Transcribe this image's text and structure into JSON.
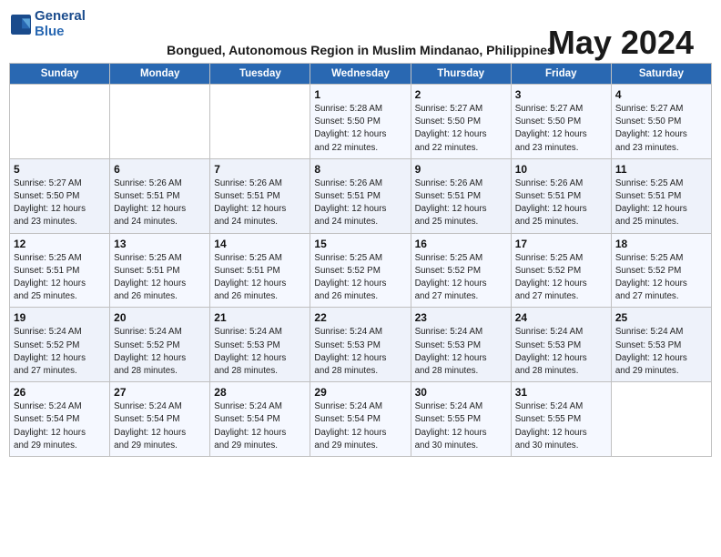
{
  "logo": {
    "line1": "General",
    "line2": "Blue"
  },
  "title": "May 2024",
  "subtitle": "Bongued, Autonomous Region in Muslim Mindanao, Philippines",
  "days_of_week": [
    "Sunday",
    "Monday",
    "Tuesday",
    "Wednesday",
    "Thursday",
    "Friday",
    "Saturday"
  ],
  "weeks": [
    [
      {
        "day": "",
        "info": ""
      },
      {
        "day": "",
        "info": ""
      },
      {
        "day": "",
        "info": ""
      },
      {
        "day": "1",
        "info": "Sunrise: 5:28 AM\nSunset: 5:50 PM\nDaylight: 12 hours\nand 22 minutes."
      },
      {
        "day": "2",
        "info": "Sunrise: 5:27 AM\nSunset: 5:50 PM\nDaylight: 12 hours\nand 22 minutes."
      },
      {
        "day": "3",
        "info": "Sunrise: 5:27 AM\nSunset: 5:50 PM\nDaylight: 12 hours\nand 23 minutes."
      },
      {
        "day": "4",
        "info": "Sunrise: 5:27 AM\nSunset: 5:50 PM\nDaylight: 12 hours\nand 23 minutes."
      }
    ],
    [
      {
        "day": "5",
        "info": "Sunrise: 5:27 AM\nSunset: 5:50 PM\nDaylight: 12 hours\nand 23 minutes."
      },
      {
        "day": "6",
        "info": "Sunrise: 5:26 AM\nSunset: 5:51 PM\nDaylight: 12 hours\nand 24 minutes."
      },
      {
        "day": "7",
        "info": "Sunrise: 5:26 AM\nSunset: 5:51 PM\nDaylight: 12 hours\nand 24 minutes."
      },
      {
        "day": "8",
        "info": "Sunrise: 5:26 AM\nSunset: 5:51 PM\nDaylight: 12 hours\nand 24 minutes."
      },
      {
        "day": "9",
        "info": "Sunrise: 5:26 AM\nSunset: 5:51 PM\nDaylight: 12 hours\nand 25 minutes."
      },
      {
        "day": "10",
        "info": "Sunrise: 5:26 AM\nSunset: 5:51 PM\nDaylight: 12 hours\nand 25 minutes."
      },
      {
        "day": "11",
        "info": "Sunrise: 5:25 AM\nSunset: 5:51 PM\nDaylight: 12 hours\nand 25 minutes."
      }
    ],
    [
      {
        "day": "12",
        "info": "Sunrise: 5:25 AM\nSunset: 5:51 PM\nDaylight: 12 hours\nand 25 minutes."
      },
      {
        "day": "13",
        "info": "Sunrise: 5:25 AM\nSunset: 5:51 PM\nDaylight: 12 hours\nand 26 minutes."
      },
      {
        "day": "14",
        "info": "Sunrise: 5:25 AM\nSunset: 5:51 PM\nDaylight: 12 hours\nand 26 minutes."
      },
      {
        "day": "15",
        "info": "Sunrise: 5:25 AM\nSunset: 5:52 PM\nDaylight: 12 hours\nand 26 minutes."
      },
      {
        "day": "16",
        "info": "Sunrise: 5:25 AM\nSunset: 5:52 PM\nDaylight: 12 hours\nand 27 minutes."
      },
      {
        "day": "17",
        "info": "Sunrise: 5:25 AM\nSunset: 5:52 PM\nDaylight: 12 hours\nand 27 minutes."
      },
      {
        "day": "18",
        "info": "Sunrise: 5:25 AM\nSunset: 5:52 PM\nDaylight: 12 hours\nand 27 minutes."
      }
    ],
    [
      {
        "day": "19",
        "info": "Sunrise: 5:24 AM\nSunset: 5:52 PM\nDaylight: 12 hours\nand 27 minutes."
      },
      {
        "day": "20",
        "info": "Sunrise: 5:24 AM\nSunset: 5:52 PM\nDaylight: 12 hours\nand 28 minutes."
      },
      {
        "day": "21",
        "info": "Sunrise: 5:24 AM\nSunset: 5:53 PM\nDaylight: 12 hours\nand 28 minutes."
      },
      {
        "day": "22",
        "info": "Sunrise: 5:24 AM\nSunset: 5:53 PM\nDaylight: 12 hours\nand 28 minutes."
      },
      {
        "day": "23",
        "info": "Sunrise: 5:24 AM\nSunset: 5:53 PM\nDaylight: 12 hours\nand 28 minutes."
      },
      {
        "day": "24",
        "info": "Sunrise: 5:24 AM\nSunset: 5:53 PM\nDaylight: 12 hours\nand 28 minutes."
      },
      {
        "day": "25",
        "info": "Sunrise: 5:24 AM\nSunset: 5:53 PM\nDaylight: 12 hours\nand 29 minutes."
      }
    ],
    [
      {
        "day": "26",
        "info": "Sunrise: 5:24 AM\nSunset: 5:54 PM\nDaylight: 12 hours\nand 29 minutes."
      },
      {
        "day": "27",
        "info": "Sunrise: 5:24 AM\nSunset: 5:54 PM\nDaylight: 12 hours\nand 29 minutes."
      },
      {
        "day": "28",
        "info": "Sunrise: 5:24 AM\nSunset: 5:54 PM\nDaylight: 12 hours\nand 29 minutes."
      },
      {
        "day": "29",
        "info": "Sunrise: 5:24 AM\nSunset: 5:54 PM\nDaylight: 12 hours\nand 29 minutes."
      },
      {
        "day": "30",
        "info": "Sunrise: 5:24 AM\nSunset: 5:55 PM\nDaylight: 12 hours\nand 30 minutes."
      },
      {
        "day": "31",
        "info": "Sunrise: 5:24 AM\nSunset: 5:55 PM\nDaylight: 12 hours\nand 30 minutes."
      },
      {
        "day": "",
        "info": ""
      }
    ]
  ]
}
